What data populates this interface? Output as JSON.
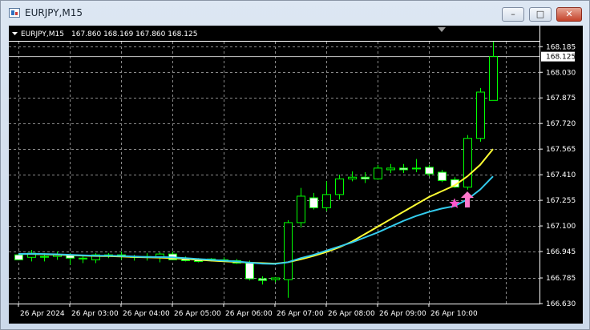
{
  "window": {
    "title": "EURJPY,M15",
    "minimize_icon": "minimize-icon",
    "maximize_icon": "maximize-icon",
    "close_icon": "close-icon"
  },
  "chart_header": {
    "symbol_label": "EURJPY,M15",
    "ohlc_text": "167.860 168.169 167.860 168.125"
  },
  "colors": {
    "background": "#000000",
    "grid": "#8a8a8a",
    "bull_candle_outline": "#00ff00",
    "bull_candle_body": "#000000",
    "bear_candle_body": "#ffffff",
    "wick": "#00ff00",
    "ma_fast": "#33ccee",
    "ma_slow": "#ffff33",
    "arrow_marker": "#ff77cc",
    "star_marker": "#ff55cc"
  },
  "chart_data": {
    "type": "candlestick",
    "title": "EURJPY,M15",
    "ylim": [
      166.63,
      168.23
    ],
    "y_ticks": [
      "168.185",
      "168.030",
      "167.875",
      "167.720",
      "167.565",
      "167.410",
      "167.255",
      "167.100",
      "166.945",
      "166.785",
      "166.630"
    ],
    "current_price_label": "168.125",
    "x_tick_labels": [
      "26 Apr 2024",
      "26 Apr 03:00",
      "26 Apr 04:00",
      "26 Apr 05:00",
      "26 Apr 06:00",
      "26 Apr 07:00",
      "26 Apr 08:00",
      "26 Apr 09:00",
      "26 Apr 10:00"
    ],
    "grid": true,
    "candles": [
      {
        "o": 166.925,
        "h": 166.935,
        "l": 166.895,
        "c": 166.895
      },
      {
        "o": 166.91,
        "h": 166.955,
        "l": 166.885,
        "c": 166.935
      },
      {
        "o": 166.915,
        "h": 166.935,
        "l": 166.885,
        "c": 166.915
      },
      {
        "o": 166.915,
        "h": 166.945,
        "l": 166.895,
        "c": 166.925
      },
      {
        "o": 166.925,
        "h": 166.935,
        "l": 166.865,
        "c": 166.905
      },
      {
        "o": 166.905,
        "h": 166.925,
        "l": 166.875,
        "c": 166.905
      },
      {
        "o": 166.895,
        "h": 166.935,
        "l": 166.875,
        "c": 166.925
      },
      {
        "o": 166.925,
        "h": 166.935,
        "l": 166.905,
        "c": 166.925
      },
      {
        "o": 166.925,
        "h": 166.945,
        "l": 166.895,
        "c": 166.915
      },
      {
        "o": 166.915,
        "h": 166.925,
        "l": 166.89,
        "c": 166.91
      },
      {
        "o": 166.91,
        "h": 166.935,
        "l": 166.89,
        "c": 166.915
      },
      {
        "o": 166.91,
        "h": 166.94,
        "l": 166.88,
        "c": 166.93
      },
      {
        "o": 166.93,
        "h": 166.945,
        "l": 166.895,
        "c": 166.895
      },
      {
        "o": 166.9,
        "h": 166.915,
        "l": 166.885,
        "c": 166.89
      },
      {
        "o": 166.895,
        "h": 166.905,
        "l": 166.88,
        "c": 166.885
      },
      {
        "o": 166.895,
        "h": 166.905,
        "l": 166.885,
        "c": 166.9
      },
      {
        "o": 166.895,
        "h": 166.91,
        "l": 166.88,
        "c": 166.89
      },
      {
        "o": 166.89,
        "h": 166.9,
        "l": 166.87,
        "c": 166.875
      },
      {
        "o": 166.875,
        "h": 166.89,
        "l": 166.77,
        "c": 166.78
      },
      {
        "o": 166.78,
        "h": 166.795,
        "l": 166.745,
        "c": 166.77
      },
      {
        "o": 166.775,
        "h": 166.79,
        "l": 166.76,
        "c": 166.785
      },
      {
        "o": 166.775,
        "h": 167.135,
        "l": 166.665,
        "c": 167.12
      },
      {
        "o": 167.12,
        "h": 167.33,
        "l": 167.09,
        "c": 167.28
      },
      {
        "o": 167.27,
        "h": 167.3,
        "l": 167.2,
        "c": 167.21
      },
      {
        "o": 167.21,
        "h": 167.37,
        "l": 167.19,
        "c": 167.29
      },
      {
        "o": 167.29,
        "h": 167.41,
        "l": 167.26,
        "c": 167.385
      },
      {
        "o": 167.385,
        "h": 167.43,
        "l": 167.37,
        "c": 167.395
      },
      {
        "o": 167.395,
        "h": 167.425,
        "l": 167.36,
        "c": 167.385
      },
      {
        "o": 167.385,
        "h": 167.47,
        "l": 167.38,
        "c": 167.45
      },
      {
        "o": 167.44,
        "h": 167.475,
        "l": 167.42,
        "c": 167.45
      },
      {
        "o": 167.45,
        "h": 167.475,
        "l": 167.42,
        "c": 167.44
      },
      {
        "o": 167.445,
        "h": 167.505,
        "l": 167.425,
        "c": 167.45
      },
      {
        "o": 167.455,
        "h": 167.47,
        "l": 167.4,
        "c": 167.415
      },
      {
        "o": 167.425,
        "h": 167.44,
        "l": 167.365,
        "c": 167.375
      },
      {
        "o": 167.38,
        "h": 167.395,
        "l": 167.33,
        "c": 167.335
      },
      {
        "o": 167.335,
        "h": 167.65,
        "l": 167.32,
        "c": 167.63
      },
      {
        "o": 167.63,
        "h": 167.935,
        "l": 167.61,
        "c": 167.91
      },
      {
        "o": 167.86,
        "h": 168.215,
        "l": 167.86,
        "c": 168.125
      }
    ],
    "series": [
      {
        "values": [
          166.93,
          166.932,
          166.93,
          166.928,
          166.925,
          166.922,
          166.92,
          166.92,
          166.918,
          166.915,
          166.912,
          166.912,
          166.91,
          166.905,
          166.9,
          166.895,
          166.89,
          166.885,
          166.878,
          166.872,
          166.87,
          166.88,
          166.905,
          166.925,
          166.95,
          166.975,
          167.0,
          167.03,
          167.06,
          167.095,
          167.13,
          167.16,
          167.185,
          167.205,
          167.22,
          167.26,
          167.32,
          167.4
        ]
      },
      {
        "values": [
          166.93,
          166.93,
          166.928,
          166.926,
          166.923,
          166.92,
          166.918,
          166.917,
          166.915,
          166.912,
          166.91,
          166.908,
          166.905,
          166.9,
          166.895,
          166.89,
          166.886,
          166.882,
          166.878,
          166.875,
          166.872,
          166.88,
          166.898,
          166.918,
          166.942,
          166.97,
          167.005,
          167.05,
          167.095,
          167.14,
          167.185,
          167.23,
          167.275,
          167.31,
          167.345,
          167.4,
          167.47,
          167.565
        ]
      }
    ],
    "markers": [
      {
        "type": "star",
        "index": 34,
        "y": 167.235
      },
      {
        "type": "arrow-up",
        "index": 35,
        "y": 167.27
      }
    ]
  }
}
